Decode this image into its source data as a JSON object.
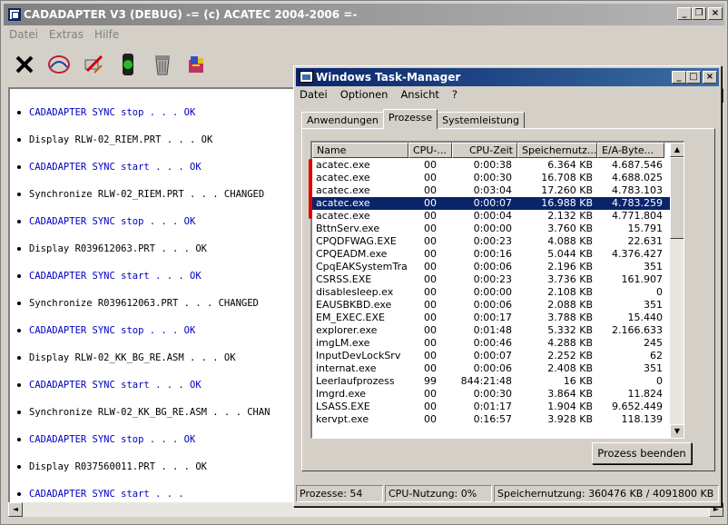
{
  "main": {
    "title": "CADADAPTER V3 (DEBUG)   -= (c) ACATEC 2004-2006 =-",
    "menu": [
      "Datei",
      "Extras",
      "Hilfe"
    ],
    "window_buttons": [
      "_",
      "❐",
      "×"
    ],
    "toolbar_icons": [
      "close-x-icon",
      "logo-icon",
      "disconnect-icon",
      "traffic-light-icon",
      "trash-icon",
      "package-icon"
    ],
    "log": [
      {
        "text": "CADADAPTER SYNC stop . . . OK",
        "kind": "sync"
      },
      {
        "text": "Display RLW-02_RIEM.PRT . . . OK",
        "kind": "normal"
      },
      {
        "text": "CADADAPTER SYNC start . . . OK",
        "kind": "sync"
      },
      {
        "text": "Synchronize RLW-02_RIEM.PRT . . . CHANGED",
        "kind": "normal"
      },
      {
        "text": "CADADAPTER SYNC stop . . . OK",
        "kind": "sync"
      },
      {
        "text": "Display R039612063.PRT . . . OK",
        "kind": "normal"
      },
      {
        "text": "CADADAPTER SYNC start . . . OK",
        "kind": "sync"
      },
      {
        "text": "Synchronize R039612063.PRT . . . CHANGED",
        "kind": "normal"
      },
      {
        "text": "CADADAPTER SYNC stop . . . OK",
        "kind": "sync"
      },
      {
        "text": "Display RLW-02_KK_BG_RE.ASM . . . OK",
        "kind": "normal"
      },
      {
        "text": "CADADAPTER SYNC start . . . OK",
        "kind": "sync"
      },
      {
        "text": "Synchronize RLW-02_KK_BG_RE.ASM . . . CHAN",
        "kind": "normal"
      },
      {
        "text": "CADADAPTER SYNC stop . . . OK",
        "kind": "sync"
      },
      {
        "text": "Display R037560011.PRT . . . OK",
        "kind": "normal"
      },
      {
        "text": "CADADAPTER SYNC start . . .",
        "kind": "sync"
      }
    ]
  },
  "taskmgr": {
    "title": "Windows Task-Manager",
    "menu": [
      "Datei",
      "Optionen",
      "Ansicht",
      "?"
    ],
    "tabs": [
      "Anwendungen",
      "Prozesse",
      "Systemleistung"
    ],
    "active_tab": "Prozesse",
    "columns": [
      "Name",
      "CPU-...",
      "CPU-Zeit",
      "Speichernutz...",
      "E/A-Byte..."
    ],
    "rows": [
      [
        "acatec.exe",
        "00",
        "0:00:38",
        "6.364 KB",
        "4.687.546"
      ],
      [
        "acatec.exe",
        "00",
        "0:00:30",
        "16.708 KB",
        "4.688.025"
      ],
      [
        "acatec.exe",
        "00",
        "0:03:04",
        "17.260 KB",
        "4.783.103"
      ],
      [
        "acatec.exe",
        "00",
        "0:00:07",
        "16.988 KB",
        "4.783.259"
      ],
      [
        "acatec.exe",
        "00",
        "0:00:04",
        "2.132 KB",
        "4.771.804"
      ],
      [
        "BttnServ.exe",
        "00",
        "0:00:00",
        "3.760 KB",
        "15.791"
      ],
      [
        "CPQDFWAG.EXE",
        "00",
        "0:00:23",
        "4.088 KB",
        "22.631"
      ],
      [
        "CPQEADM.exe",
        "00",
        "0:00:16",
        "5.044 KB",
        "4.376.427"
      ],
      [
        "CpqEAKSystemTra",
        "00",
        "0:00:06",
        "2.196 KB",
        "351"
      ],
      [
        "CSRSS.EXE",
        "00",
        "0:00:23",
        "3.736 KB",
        "161.907"
      ],
      [
        "disablesleep.ex",
        "00",
        "0:00:00",
        "2.108 KB",
        "0"
      ],
      [
        "EAUSBKBD.exe",
        "00",
        "0:00:06",
        "2.088 KB",
        "351"
      ],
      [
        "EM_EXEC.EXE",
        "00",
        "0:00:17",
        "3.788 KB",
        "15.440"
      ],
      [
        "explorer.exe",
        "00",
        "0:01:48",
        "5.332 KB",
        "2.166.633"
      ],
      [
        "imgLM.exe",
        "00",
        "0:00:46",
        "4.288 KB",
        "245"
      ],
      [
        "InputDevLockSrv",
        "00",
        "0:00:07",
        "2.252 KB",
        "62"
      ],
      [
        "internat.exe",
        "00",
        "0:00:06",
        "2.408 KB",
        "351"
      ],
      [
        "Leerlaufprozess",
        "99",
        "844:21:48",
        "16 KB",
        "0"
      ],
      [
        "lmgrd.exe",
        "00",
        "0:00:30",
        "3.864 KB",
        "11.824"
      ],
      [
        "LSASS.EXE",
        "00",
        "0:01:17",
        "1.904 KB",
        "9.652.449"
      ],
      [
        "kervpt.exe",
        "00",
        "0:16:57",
        "3.928 KB",
        "118.139"
      ]
    ],
    "selected_row": 3,
    "end_button": "Prozess beenden",
    "status": {
      "processes": "Prozesse: 54",
      "cpu": "CPU-Nutzung: 0%",
      "memory": "Speichernutzung: 360476 KB / 4091800 KB"
    }
  },
  "colors": {
    "title_active": "#0a246a",
    "selection": "#0a246a",
    "sync_text": "#0000c0",
    "annotation": "#e00000"
  }
}
